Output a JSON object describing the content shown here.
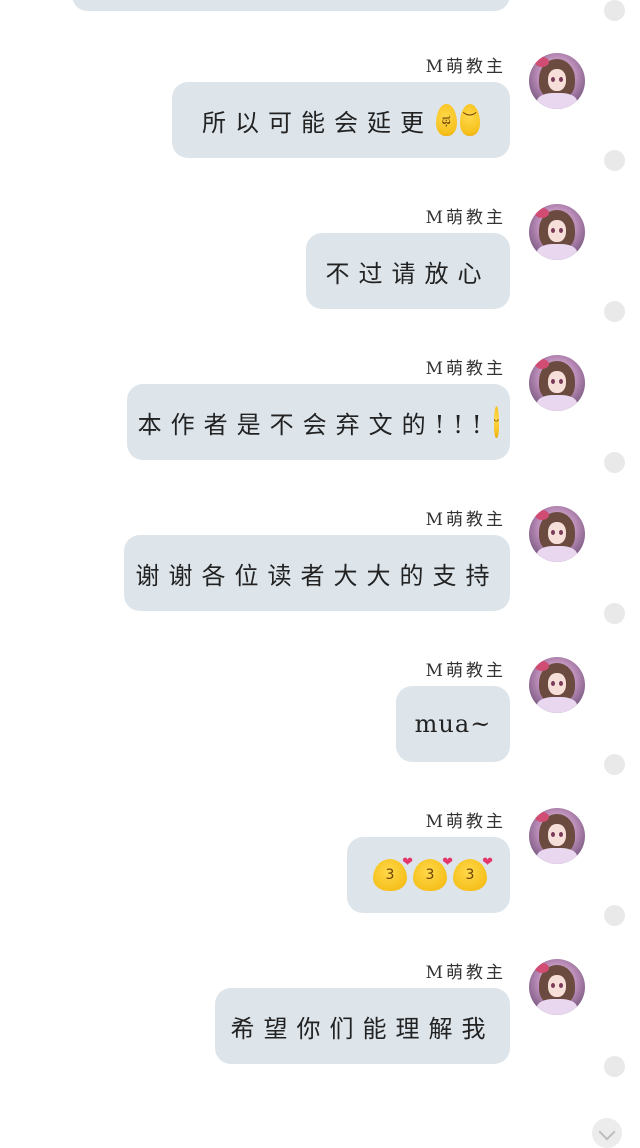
{
  "sender_name": "M萌教主",
  "messages": [
    {
      "text": "所以可能会延更",
      "emojis": [
        {
          "name": "crying-blob-emoji",
          "face": "ಥ"
        },
        {
          "name": "sad-blob-emoji",
          "face": "︶"
        }
      ]
    },
    {
      "text": "不过请放心",
      "emojis": []
    },
    {
      "text": "本作者是不会弃文的!!!",
      "emojis": [
        {
          "name": "wink-blob-emoji",
          "face": "ᵕ"
        }
      ]
    },
    {
      "text": "谢谢各位读者大大的支持",
      "emojis": []
    },
    {
      "text": "mua~",
      "emojis": []
    },
    {
      "text": "",
      "emojis": [
        {
          "name": "kiss-heart-blob-emoji",
          "face": "3",
          "heart": "❤"
        },
        {
          "name": "kiss-heart-blob-emoji",
          "face": "3",
          "heart": "❤"
        },
        {
          "name": "kiss-heart-blob-emoji",
          "face": "3",
          "heart": "❤"
        }
      ]
    },
    {
      "text": "希望你们能理解我",
      "emojis": []
    }
  ]
}
